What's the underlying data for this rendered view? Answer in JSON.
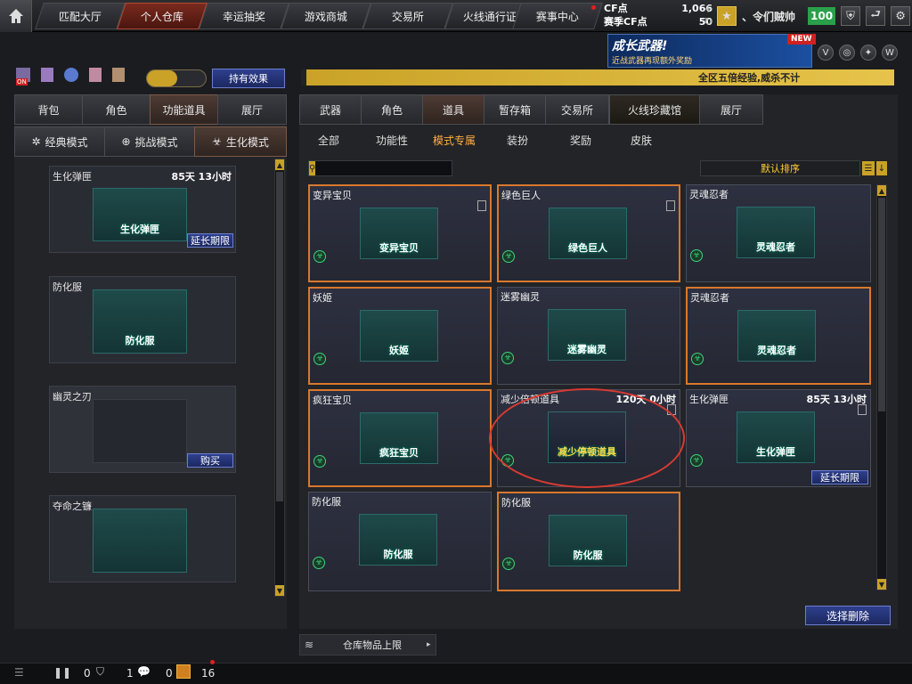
{
  "topnav": {
    "tabs": [
      "匹配大厅",
      "个人仓库",
      "幸运抽奖",
      "游戏商城",
      "交易所",
      "火线通行证",
      "赛事中心"
    ],
    "cf_label": "CF点",
    "cf_value": "1,066",
    "season_cf_label": "赛季CF点",
    "season_cf_value": "50",
    "username": "、令们贼帅",
    "level": "100"
  },
  "banner": {
    "title": "成长武器!",
    "subtitle": "近战武器再现额外奖励",
    "badge": "NEW"
  },
  "effects": {
    "button_label": "持有效果",
    "on_label": "ON"
  },
  "marquee": {
    "text": "全区五倍经验,威杀不计"
  },
  "left": {
    "tabs": [
      "背包",
      "角色",
      "功能道具",
      "展厅"
    ],
    "mode_tabs": [
      "经典模式",
      "挑战模式",
      "生化模式"
    ],
    "items": [
      {
        "name": "生化弹匣",
        "time": "85天 13小时",
        "label": "生化弹匣",
        "button": "延长期限"
      },
      {
        "name": "防化服",
        "label": "防化服"
      },
      {
        "name": "幽灵之刃",
        "button": "购买"
      },
      {
        "name": "夺命之镰"
      }
    ]
  },
  "right": {
    "tabs": [
      "武器",
      "角色",
      "道具",
      "暂存箱",
      "交易所",
      "火线珍藏馆",
      "展厅"
    ],
    "sub_tabs": [
      "全部",
      "功能性",
      "模式专属",
      "装扮",
      "奖励",
      "皮肤"
    ],
    "search_placeholder": "",
    "sort_label": "默认排序",
    "items": [
      {
        "name": "变异宝贝",
        "label": "变异宝贝"
      },
      {
        "name": "绿色巨人",
        "label": "绿色巨人"
      },
      {
        "name": "灵魂忍者",
        "label": "灵魂忍者"
      },
      {
        "name": "妖姬",
        "label": "妖姬"
      },
      {
        "name": "迷雾幽灵",
        "label": "迷雾幽灵"
      },
      {
        "name": "灵魂忍者",
        "label": "灵魂忍者"
      },
      {
        "name": "疯狂宝贝",
        "label": "疯狂宝贝"
      },
      {
        "name": "减少倍顿道具",
        "time": "120天 0小时",
        "label": "减少停顿道具"
      },
      {
        "name": "生化弹匣",
        "time": "85天 13小时",
        "label": "生化弹匣",
        "button": "延长期限"
      },
      {
        "name": "防化服",
        "label": "防化服"
      },
      {
        "name": "防化服",
        "label": "防化服"
      }
    ],
    "delete_button": "选择删除",
    "storage_label": "仓库物品上限"
  },
  "bottombar": {
    "count_a": "0",
    "count_b": "1",
    "count_c": "0",
    "count_d": "16"
  }
}
